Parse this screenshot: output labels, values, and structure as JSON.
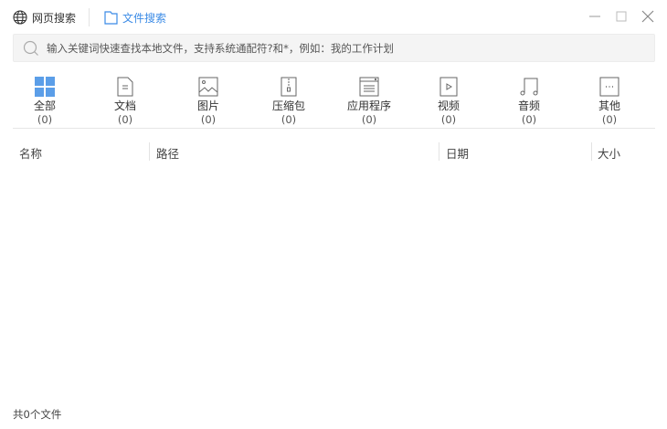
{
  "tabs": [
    {
      "label": "网页搜索"
    },
    {
      "label": "文件搜索"
    }
  ],
  "search": {
    "placeholder": "输入关键词快速查找本地文件，支持系统通配符?和*，例如：我的工作计划"
  },
  "categories": [
    {
      "label": "全部",
      "count": "(0)",
      "icon": "grid-icon"
    },
    {
      "label": "文档",
      "count": "(0)",
      "icon": "document-icon"
    },
    {
      "label": "图片",
      "count": "(0)",
      "icon": "image-icon"
    },
    {
      "label": "压缩包",
      "count": "(0)",
      "icon": "archive-icon"
    },
    {
      "label": "应用程序",
      "count": "(0)",
      "icon": "application-icon"
    },
    {
      "label": "视频",
      "count": "(0)",
      "icon": "video-icon"
    },
    {
      "label": "音频",
      "count": "(0)",
      "icon": "audio-icon"
    },
    {
      "label": "其他",
      "count": "(0)",
      "icon": "other-icon"
    }
  ],
  "columns": [
    "名称",
    "路径",
    "日期",
    "大小"
  ],
  "status": "共0个文件",
  "colors": {
    "accent": "#3b8be6",
    "active_icon": "#5b9ee8"
  }
}
